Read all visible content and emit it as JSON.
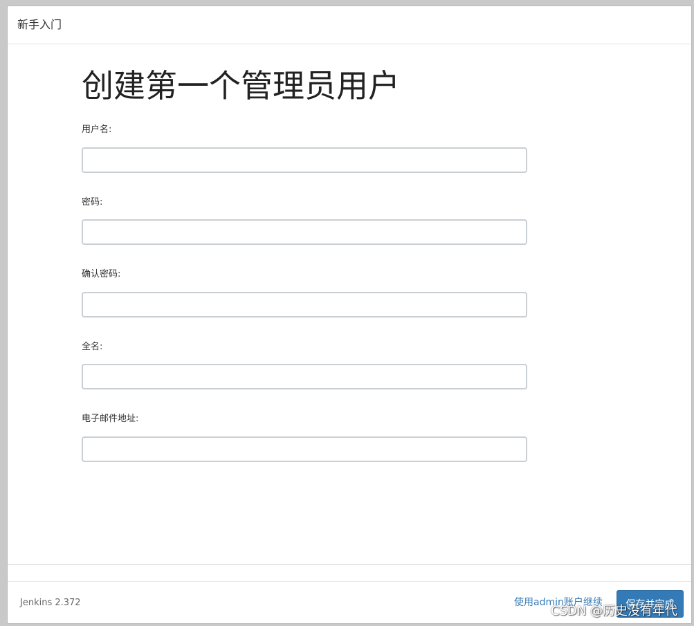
{
  "dialog": {
    "title": "新手入门"
  },
  "main": {
    "heading": "创建第一个管理员用户",
    "fields": [
      {
        "label": "用户名:",
        "value": ""
      },
      {
        "label": "密码:",
        "value": ""
      },
      {
        "label": "确认密码:",
        "value": ""
      },
      {
        "label": "全名:",
        "value": ""
      },
      {
        "label": "电子邮件地址:",
        "value": ""
      }
    ]
  },
  "footer": {
    "version": "Jenkins 2.372",
    "admin_link": "使用admin账户继续",
    "save_label": "保存并完成"
  },
  "watermark": "CSDN @历史没有年代",
  "colors": {
    "accent": "#337ab7",
    "input_border": "#c9cfd3",
    "backdrop": "#c9c9c9"
  }
}
